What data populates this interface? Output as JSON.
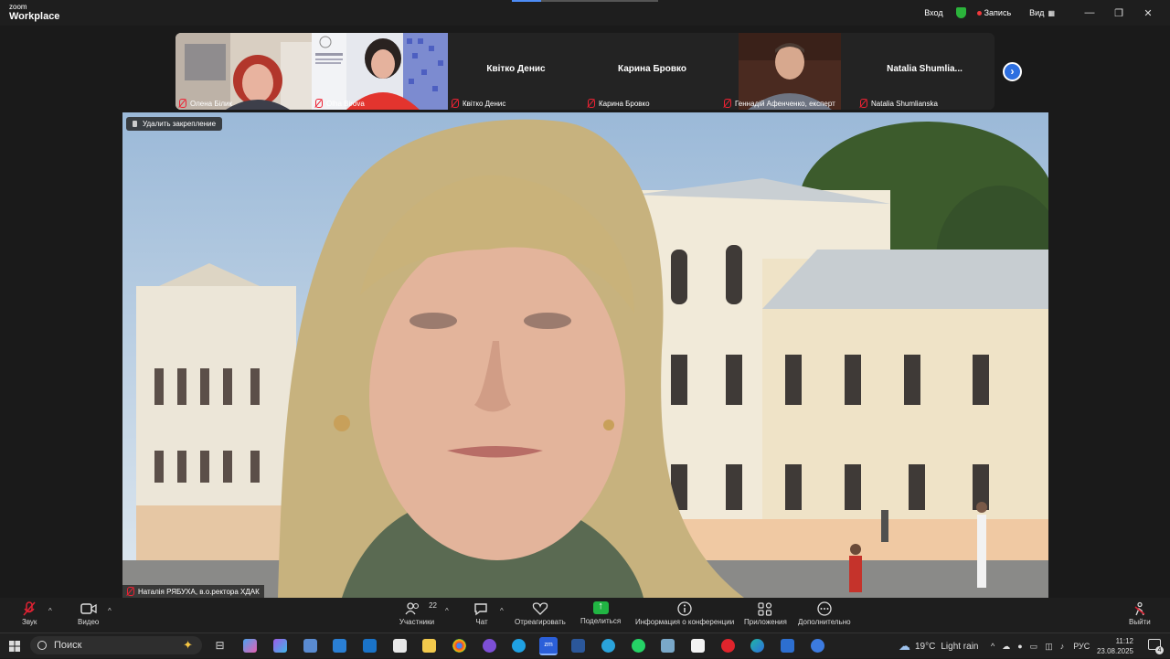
{
  "app": {
    "brand_small": "zoom",
    "brand_large": "Workplace"
  },
  "titlebar": {
    "enter": "Вход",
    "record": "Запись",
    "view": "Вид",
    "minimize": "—",
    "restore": "❐",
    "close": "✕"
  },
  "thumbnails": [
    {
      "name": "Олена Білик",
      "video": true,
      "muted": true
    },
    {
      "name": "Olha Birova",
      "video": true,
      "muted": true
    },
    {
      "name": "Квітко Денис",
      "display": "Квітко Денис",
      "video": false,
      "muted": true
    },
    {
      "name": "Карина Бровко",
      "display": "Карина Бровко",
      "video": false,
      "muted": true
    },
    {
      "name": "Геннадій Афенченко, експерт",
      "video": true,
      "muted": true
    },
    {
      "name": "Natalia Shumlianska",
      "display": "Natalia  Shumlia...",
      "video": false,
      "muted": true
    }
  ],
  "main": {
    "unpin_label": "Удалить закрепление",
    "speaker_name": "Наталія РЯБУХА, в.о.ректора ХДАК"
  },
  "toolbar": {
    "audio": "Звук",
    "video": "Видео",
    "participants": "Участники",
    "participants_count": "22",
    "chat": "Чат",
    "react": "Отреагировать",
    "share": "Поделиться",
    "info": "Информация о конференции",
    "apps": "Приложения",
    "more": "Дополнительно",
    "leave": "Выйти"
  },
  "taskbar": {
    "search_placeholder": "Поиск",
    "weather_temp": "19°C",
    "weather_desc": "Light rain",
    "lang": "РУС",
    "time": "11:12",
    "date": "23.08.2025",
    "notifications": "4"
  },
  "colors": {
    "accent": "#2d6fe0",
    "share": "#21b543",
    "record": "#f0393c",
    "muted": "#e02233"
  }
}
